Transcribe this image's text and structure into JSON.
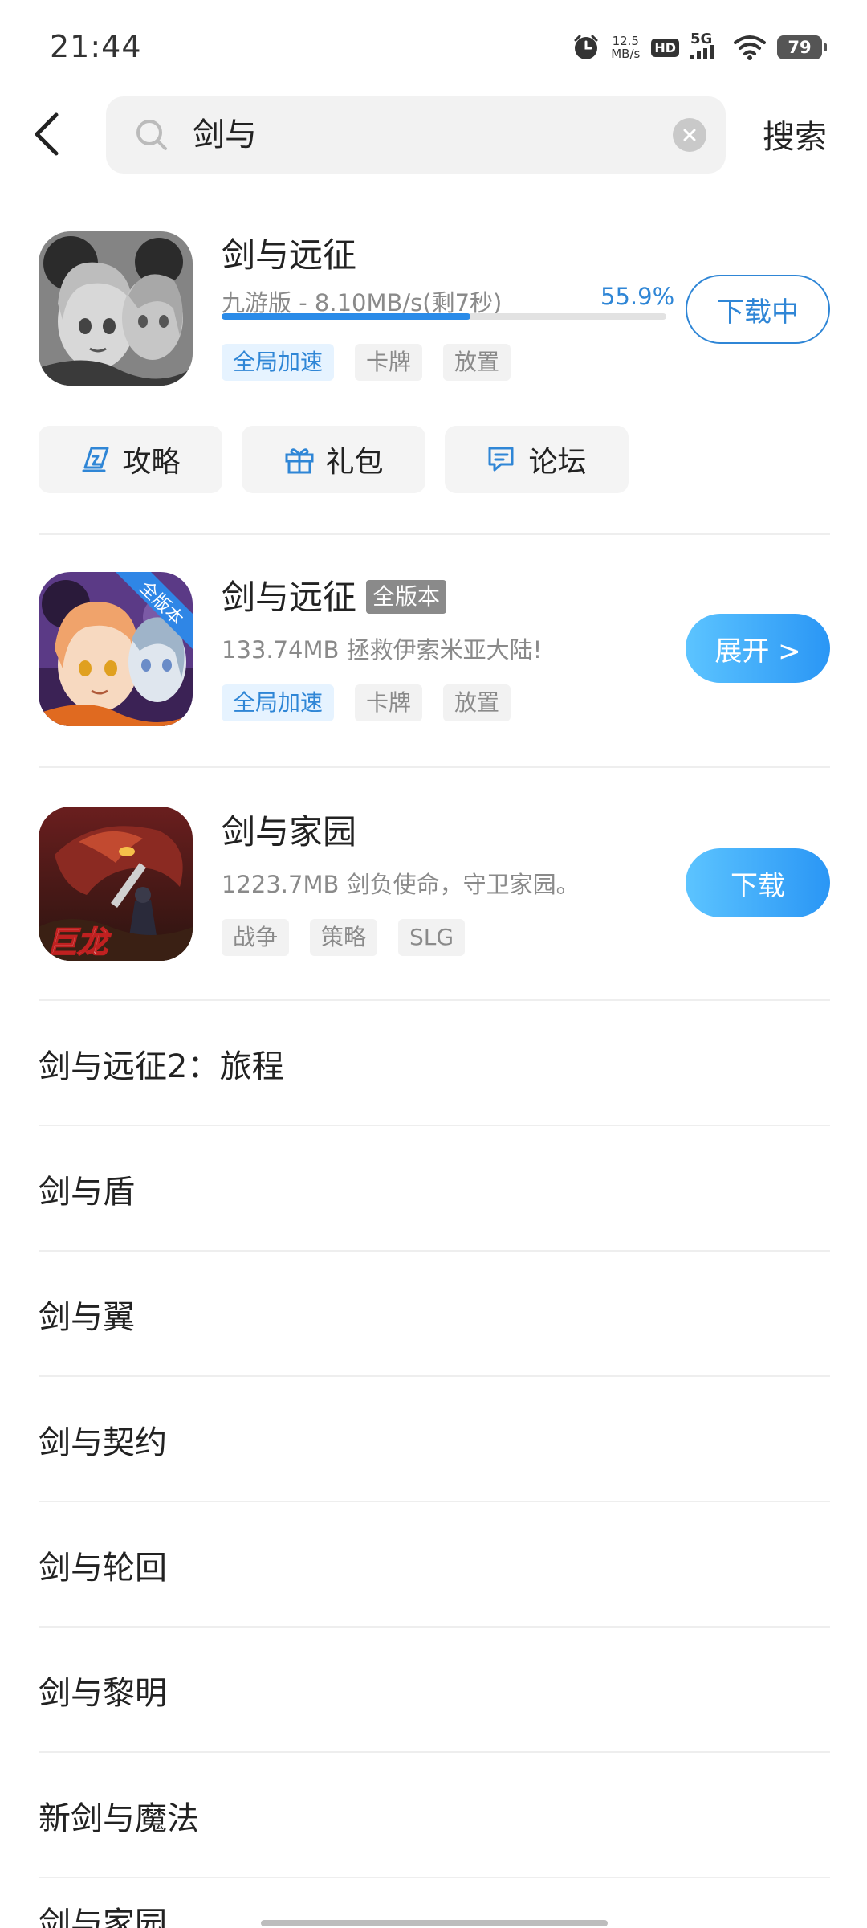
{
  "status_bar": {
    "time": "21:44",
    "net_speed_value": "12.5",
    "net_speed_unit": "MB/s",
    "hd_label": "HD",
    "network_label": "5G",
    "battery": "79"
  },
  "search": {
    "query": "剑与",
    "submit_label": "搜索"
  },
  "apps": [
    {
      "name": "剑与远征",
      "meta": "九游版  -  8.10MB/s(剩7秒)",
      "progress_label": "55.9%",
      "progress_value": 0.559,
      "tags": [
        "全局加速",
        "卡牌",
        "放置"
      ],
      "action": "下载中"
    },
    {
      "name": "剑与远征",
      "badge": "全版本",
      "icon_ribbon": "全版本",
      "meta": "133.74MB    拯救伊索米亚大陆!",
      "tags": [
        "全局加速",
        "卡牌",
        "放置"
      ],
      "action": "展开 >"
    },
    {
      "name": "剑与家园",
      "meta": "1223.7MB    剑负使命，守卫家园。",
      "icon_caption": "巨龙",
      "tags": [
        "战争",
        "策略",
        "SLG"
      ],
      "action": "下载"
    }
  ],
  "quick_links": [
    {
      "label": "攻略",
      "icon": "strategy-icon"
    },
    {
      "label": "礼包",
      "icon": "gift-icon"
    },
    {
      "label": "论坛",
      "icon": "forum-icon"
    }
  ],
  "suggestions": [
    "剑与远征2：旅程",
    "剑与盾",
    "剑与翼",
    "剑与契约",
    "剑与轮回",
    "剑与黎明",
    "新剑与魔法",
    "剑与家园"
  ],
  "colors": {
    "accent": "#2f86d6",
    "button_gradient_start": "#5cc4ff",
    "button_gradient_end": "#2a96f5",
    "tag_accel_bg": "#e6f3ff"
  }
}
